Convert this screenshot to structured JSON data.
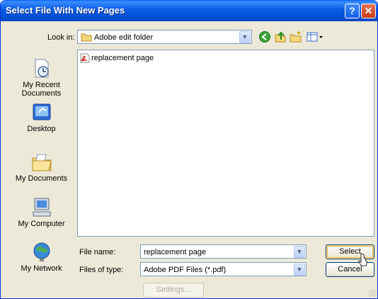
{
  "window": {
    "title": "Select File With New Pages",
    "help_glyph": "?",
    "close_glyph": "✕"
  },
  "lookin": {
    "label": "Look in:",
    "value": "Adobe edit folder"
  },
  "toolbar": {
    "back": "back-icon",
    "up": "up-folder-icon",
    "new_folder": "new-folder-icon",
    "views": "views-menu-icon"
  },
  "places": [
    {
      "name": "recent",
      "label": "My Recent Documents"
    },
    {
      "name": "desktop",
      "label": "Desktop"
    },
    {
      "name": "documents",
      "label": "My Documents"
    },
    {
      "name": "computer",
      "label": "My Computer"
    },
    {
      "name": "network",
      "label": "My Network"
    }
  ],
  "files": [
    {
      "name": "replacement page",
      "icon": "pdf-file-icon"
    }
  ],
  "filename": {
    "label": "File name:",
    "value": "replacement page"
  },
  "filetype": {
    "label": "Files of type:",
    "value": "Adobe PDF Files (*.pdf)"
  },
  "buttons": {
    "select": "Select",
    "cancel": "Cancel",
    "settings": "Settings..."
  },
  "colors": {
    "titlebar": "#0a5ce8",
    "dialog_bg": "#ece9d8",
    "close_button": "#c83b13"
  }
}
